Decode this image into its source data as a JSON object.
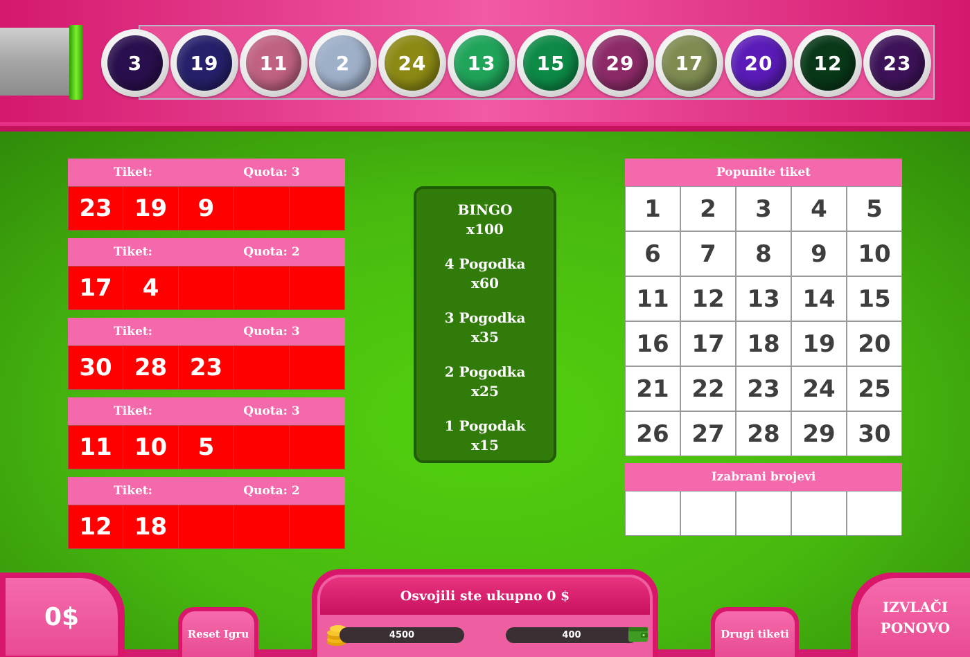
{
  "drawn_balls": [
    {
      "number": "3",
      "color": "#2a0f4e"
    },
    {
      "number": "19",
      "color": "#26206b"
    },
    {
      "number": "11",
      "color": "#c06282"
    },
    {
      "number": "2",
      "color": "#9fb0c9"
    },
    {
      "number": "24",
      "color": "#8c8a14"
    },
    {
      "number": "13",
      "color": "#1fa45a"
    },
    {
      "number": "15",
      "color": "#0c8a46"
    },
    {
      "number": "29",
      "color": "#8c2a68"
    },
    {
      "number": "17",
      "color": "#7e8c52"
    },
    {
      "number": "20",
      "color": "#5a1bb8"
    },
    {
      "number": "12",
      "color": "#083818"
    },
    {
      "number": "23",
      "color": "#3d1258"
    }
  ],
  "tickets": [
    {
      "label": "Tiket:",
      "quota": "Quota: 3",
      "numbers": [
        "23",
        "19",
        "9",
        "",
        ""
      ]
    },
    {
      "label": "Tiket:",
      "quota": "Quota: 2",
      "numbers": [
        "17",
        "4",
        "",
        "",
        ""
      ]
    },
    {
      "label": "Tiket:",
      "quota": "Quota: 3",
      "numbers": [
        "30",
        "28",
        "23",
        "",
        ""
      ]
    },
    {
      "label": "Tiket:",
      "quota": "Quota: 3",
      "numbers": [
        "11",
        "10",
        "5",
        "",
        ""
      ]
    },
    {
      "label": "Tiket:",
      "quota": "Quota: 2",
      "numbers": [
        "12",
        "18",
        "",
        "",
        ""
      ]
    }
  ],
  "paytable": [
    {
      "name": "BINGO",
      "multiplier": "x100"
    },
    {
      "name": "4 Pogodka",
      "multiplier": "x60"
    },
    {
      "name": "3 Pogodka",
      "multiplier": "x35"
    },
    {
      "name": "2 Pogodka",
      "multiplier": "x25"
    },
    {
      "name": "1 Pogodak",
      "multiplier": "x15"
    }
  ],
  "picker": {
    "title": "Popunite tiket",
    "numbers": [
      "1",
      "2",
      "3",
      "4",
      "5",
      "6",
      "7",
      "8",
      "9",
      "10",
      "11",
      "12",
      "13",
      "14",
      "15",
      "16",
      "17",
      "18",
      "19",
      "20",
      "21",
      "22",
      "23",
      "24",
      "25",
      "26",
      "27",
      "28",
      "29",
      "30"
    ]
  },
  "selected": {
    "title": "Izabrani brojevi",
    "slots": [
      "",
      "",
      "",
      "",
      ""
    ]
  },
  "bottom": {
    "balance": "0$",
    "reset_label": "Reset Igru",
    "win_text": "Osvojili ste ukupno 0 $",
    "coins_value": "4500",
    "wallet_value": "400",
    "other_tickets_label": "Drugi tiketi",
    "draw_line1": "IZVLAČI",
    "draw_line2": "PONOVO"
  },
  "icons": {
    "coins": "coin-stack-icon",
    "wallet": "wallet-icon"
  }
}
